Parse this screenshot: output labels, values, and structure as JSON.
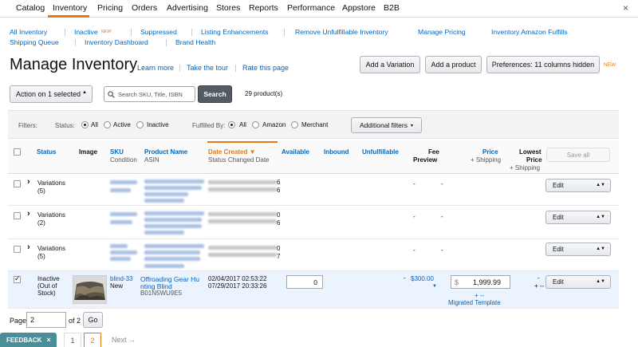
{
  "topnav": [
    "Catalog",
    "Inventory",
    "Pricing",
    "Orders",
    "Advertising",
    "Stores",
    "Reports",
    "Performance",
    "Appstore",
    "B2B"
  ],
  "close_glyph": "×",
  "subnav": {
    "all_inventory": "All Inventory",
    "inactive": "Inactive",
    "new_badge": "NEW",
    "suppressed": "Suppressed",
    "listing_enhancements": "Listing Enhancements",
    "remove_unfulfillable": "Remove Unfulfillable Inventory",
    "manage_pricing": "Manage Pricing",
    "inventory_amazon": "Inventory Amazon Fulfills",
    "shipping_queue": "Shipping Queue",
    "inventory_dashboard": "Inventory Dashboard",
    "brand_health": "Brand Health"
  },
  "heading": {
    "title": "Manage Inventory",
    "learn_more": "Learn more",
    "take_tour": "Take the tour",
    "rate_page": "Rate this page",
    "add_variation": "Add a Variation",
    "add_product": "Add a product",
    "preferences": "Preferences: 11 columns hidden",
    "new_badge": "NEW"
  },
  "actions": {
    "action_select": "Action on 1 selected",
    "search_placeholder": "Search SKU, Title, ISBN",
    "search_button": "Search",
    "product_count": "29 product(s)"
  },
  "filters": {
    "label": "Filters:",
    "status_label": "Status:",
    "status_all": "All",
    "status_active": "Active",
    "status_inactive": "Inactive",
    "fulfilled_label": "Fulfilled By:",
    "fulfilled_all": "All",
    "fulfilled_amazon": "Amazon",
    "fulfilled_merchant": "Merchant",
    "additional": "Additional filters"
  },
  "table": {
    "headers": {
      "status": "Status",
      "image": "Image",
      "sku": "SKU",
      "condition": "Condition",
      "product_name": "Product Name",
      "asin": "ASIN",
      "date_created": "Date Created",
      "status_changed": "Status Changed Date",
      "available": "Available",
      "inbound": "Inbound",
      "unfulfillable": "Unfulfillable",
      "fee_preview_1": "Fee",
      "fee_preview_2": "Preview",
      "price": "Price",
      "plus_shipping": "+ Shipping",
      "lowest_1": "Lowest",
      "lowest_2": "Price",
      "lowest_3": "+ Shipping",
      "save_all": "Save all"
    },
    "rows": [
      {
        "status_1": "Variations",
        "status_2": "(5)",
        "date_tail_1": "6",
        "date_tail_2": "6",
        "fee": "-",
        "price": "-",
        "edit": "Edit"
      },
      {
        "status_1": "Variations",
        "status_2": "(2)",
        "date_tail_1": "0",
        "date_tail_2": "6",
        "fee": "-",
        "price": "-",
        "edit": "Edit"
      },
      {
        "status_1": "Variations",
        "status_2": "(5)",
        "date_tail_1": "0",
        "date_tail_2": "7",
        "fee": "-",
        "price": "-",
        "edit": "Edit"
      }
    ],
    "detail_row": {
      "status_1": "Inactive",
      "status_2": "(Out of",
      "status_3": "Stock)",
      "sku": "blind-33",
      "condition": "New",
      "name_1": "Offroading Gear Hu",
      "name_2": "nting Blind",
      "asin": "B01N5WU9E5",
      "date_created": "02/04/2017 02:53:22",
      "status_changed": "07/29/2017 20:33:26",
      "available": "0",
      "dash": "-",
      "fee": "$300.00",
      "currency": "$",
      "price": "1,999.99",
      "plus_dash": "+ --",
      "migrated": "Migrated Template",
      "lowest_dash": "-",
      "lowest_plus": "+ --",
      "edit": "Edit"
    }
  },
  "pagination": {
    "page_label": "Page",
    "page_value": "2",
    "of_label": "of 2",
    "go": "Go",
    "feedback": "FEEDBACK",
    "feedback_close": "×",
    "pages": [
      "1",
      "2"
    ],
    "next": "Next →"
  },
  "colors": {
    "accent": "#e47911",
    "link": "#0066c0",
    "selected_row": "#eaf3fe"
  }
}
